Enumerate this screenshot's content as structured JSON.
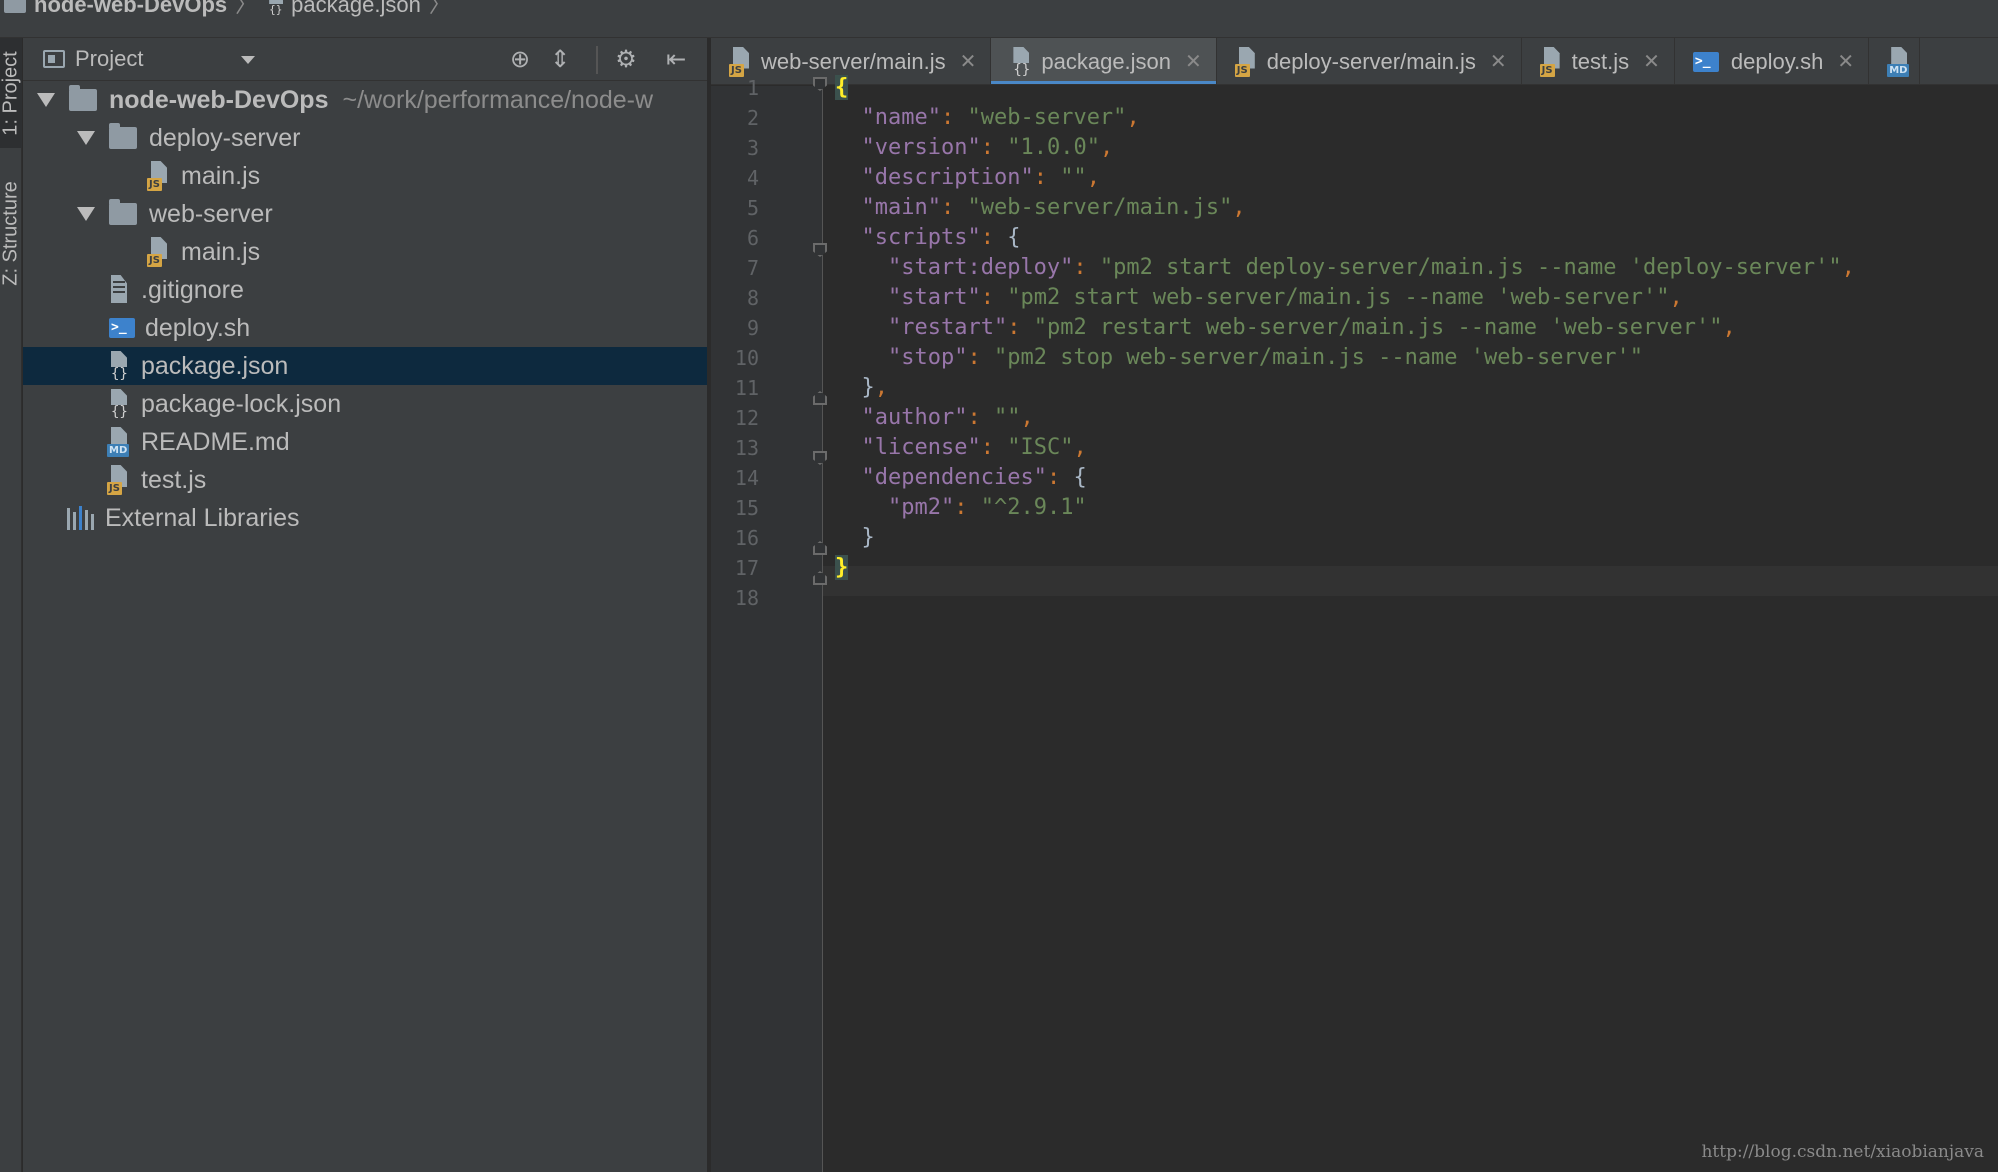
{
  "breadcrumb": {
    "project": "node-web-DevOps",
    "file": "package.json"
  },
  "toolstrip": {
    "project_tab": "1: Project",
    "structure_tab": "Z: Structure"
  },
  "project_panel": {
    "title": "Project",
    "root": {
      "name": "node-web-DevOps",
      "path": "~/work/performance/node-w"
    },
    "items": [
      {
        "label": "deploy-server",
        "type": "folder"
      },
      {
        "label": "main.js",
        "type": "js"
      },
      {
        "label": "web-server",
        "type": "folder"
      },
      {
        "label": "main.js",
        "type": "js"
      },
      {
        "label": ".gitignore",
        "type": "text"
      },
      {
        "label": "deploy.sh",
        "type": "sh"
      },
      {
        "label": "package.json",
        "type": "json"
      },
      {
        "label": "package-lock.json",
        "type": "json"
      },
      {
        "label": "README.md",
        "type": "md"
      },
      {
        "label": "test.js",
        "type": "js"
      }
    ],
    "external": "External Libraries",
    "selected_item": "package.json"
  },
  "tabs": [
    {
      "label": "web-server/main.js",
      "type": "js",
      "active": false
    },
    {
      "label": "package.json",
      "type": "json",
      "active": true
    },
    {
      "label": "deploy-server/main.js",
      "type": "js",
      "active": false
    },
    {
      "label": "test.js",
      "type": "js",
      "active": false
    },
    {
      "label": "deploy.sh",
      "type": "sh",
      "active": false
    }
  ],
  "editor": {
    "line_numbers": [
      "1",
      "2",
      "3",
      "4",
      "5",
      "6",
      "7",
      "8",
      "9",
      "10",
      "11",
      "12",
      "13",
      "14",
      "15",
      "16",
      "17",
      "18"
    ],
    "code": {
      "name_key": "\"name\"",
      "name_val": "\"web-server\"",
      "version_key": "\"version\"",
      "version_val": "\"1.0.0\"",
      "description_key": "\"description\"",
      "description_val": "\"\"",
      "main_key": "\"main\"",
      "main_val": "\"web-server/main.js\"",
      "scripts_key": "\"scripts\"",
      "start_deploy_key": "\"start:deploy\"",
      "start_deploy_val": "\"pm2 start deploy-server/main.js --name 'deploy-server'\"",
      "start_key": "\"start\"",
      "start_val": "\"pm2 start web-server/main.js --name 'web-server'\"",
      "restart_key": "\"restart\"",
      "restart_val": "\"pm2 restart web-server/main.js --name 'web-server'\"",
      "stop_key": "\"stop\"",
      "stop_val": "\"pm2 stop web-server/main.js --name 'web-server'\"",
      "author_key": "\"author\"",
      "author_val": "\"\"",
      "license_key": "\"license\"",
      "license_val": "\"ISC\"",
      "deps_key": "\"dependencies\"",
      "pm2_key": "\"pm2\"",
      "pm2_val": "\"^2.9.1\""
    }
  },
  "watermark": "http://blog.csdn.net/xiaobianjava"
}
